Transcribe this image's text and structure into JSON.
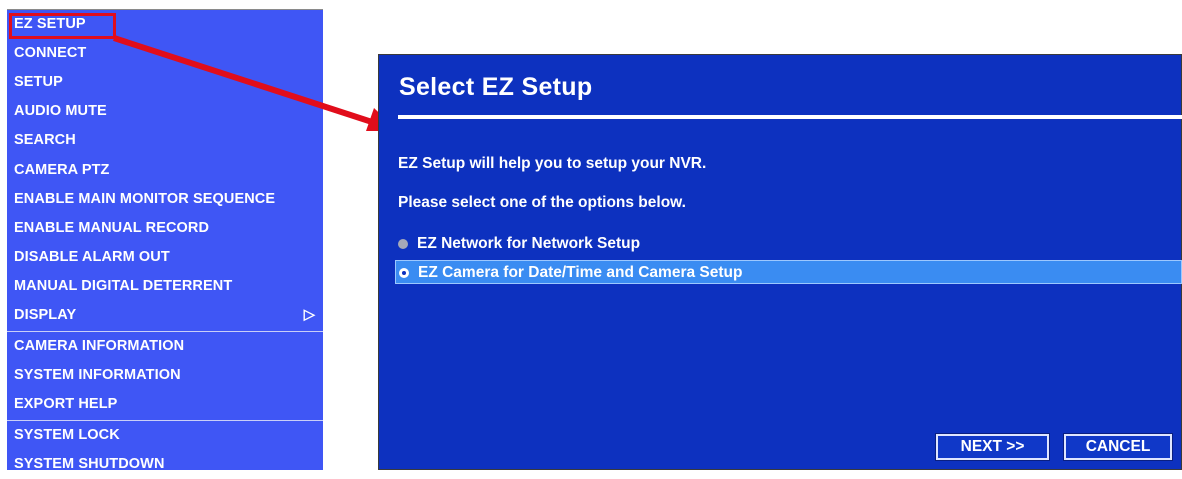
{
  "menu": {
    "items": [
      {
        "label": "EZ SETUP"
      },
      {
        "label": "CONNECT"
      },
      {
        "label": "SETUP"
      },
      {
        "label": "AUDIO MUTE"
      },
      {
        "label": "SEARCH"
      },
      {
        "label": "CAMERA PTZ"
      },
      {
        "label": "ENABLE MAIN MONITOR SEQUENCE"
      },
      {
        "label": "ENABLE MANUAL RECORD"
      },
      {
        "label": "DISABLE ALARM OUT"
      },
      {
        "label": "MANUAL DIGITAL DETERRENT"
      },
      {
        "label": "DISPLAY",
        "submenu_icon": "chevron-right-icon"
      },
      {
        "label": "CAMERA INFORMATION"
      },
      {
        "label": "SYSTEM INFORMATION"
      },
      {
        "label": "EXPORT HELP"
      },
      {
        "label": "SYSTEM LOCK"
      },
      {
        "label": "SYSTEM SHUTDOWN"
      }
    ],
    "submenu_glyph": "▷",
    "highlighted_item": "EZ SETUP"
  },
  "dialog": {
    "title": "Select  EZ  Setup",
    "intro": "EZ  Setup  will  help  you  to  setup  your  NVR.",
    "prompt": "Please  select  one  of  the  options  below.",
    "options": [
      {
        "label": "EZ  Network  for  Network  Setup",
        "selected": false
      },
      {
        "label": "EZ  Camera  for  Date/Time  and  Camera  Setup",
        "selected": true
      }
    ],
    "buttons": {
      "next": "NEXT  >>",
      "cancel": "CANCEL"
    }
  },
  "colors": {
    "menu_bg": "#3f56f5",
    "dialog_bg": "#0d31bf",
    "selected_row": "#3a8cf2",
    "annotation_red": "#e10d1b"
  }
}
